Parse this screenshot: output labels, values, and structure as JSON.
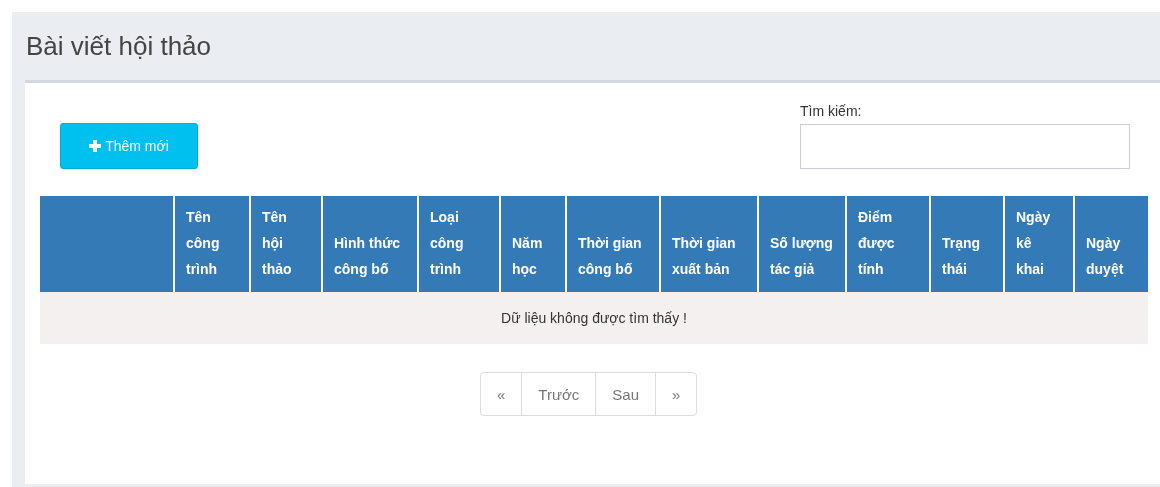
{
  "panel": {
    "title": "Bài viết hội thảo"
  },
  "add_button": {
    "label": "Thêm mới"
  },
  "search": {
    "label": "Tìm kiếm:"
  },
  "table": {
    "columns": [
      "Tên công trình",
      "Tên hội thảo",
      "Hình thức công bố",
      "Loại công trình",
      "Năm học",
      "Thời gian công bố",
      "Thời gian xuất bản",
      "Số lượng tác giả",
      "Điểm được tính",
      "Trạng thái",
      "Ngày kê khai",
      "Ngày duyệt"
    ],
    "empty_message": "Dữ liệu không được tìm thấy !"
  },
  "pagination": [
    "«",
    "Trước",
    "Sau",
    "»"
  ]
}
